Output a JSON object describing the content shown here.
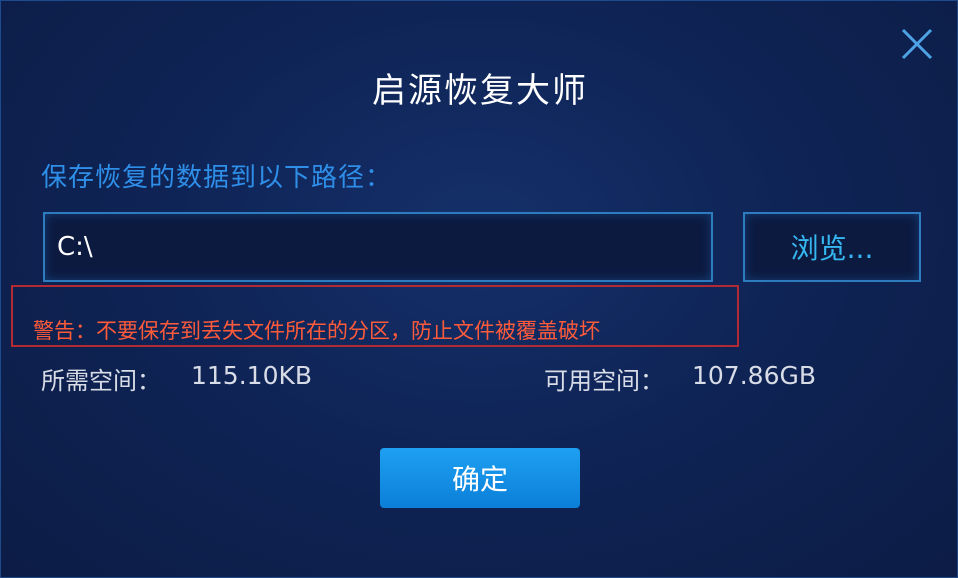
{
  "dialog": {
    "title": "启源恢复大师",
    "close_icon": "close-icon",
    "save_path_label": "保存恢复的数据到以下路径：",
    "path_value": "C:\\",
    "browse_label": "浏览...",
    "warning": "警告：不要保存到丢失文件所在的分区，防止文件被覆盖破坏",
    "required_space_label": "所需空间：",
    "required_space_value": "115.10KB",
    "available_space_label": "可用空间：",
    "available_space_value": "107.86GB",
    "confirm_label": "确定"
  },
  "colors": {
    "background": "#0f2456",
    "accent": "#2e8ee8",
    "warning": "#ff5a3a",
    "warning_border": "#b42a33",
    "button": "#1090e5"
  }
}
